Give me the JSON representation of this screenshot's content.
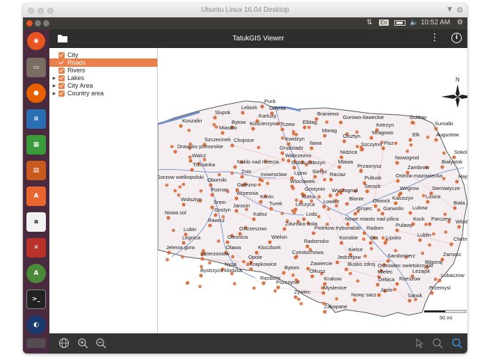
{
  "window": {
    "title": "Ubuntu Linux 16.04 Desktop"
  },
  "top_panel": {
    "lang": "En",
    "time": "10:52 AM"
  },
  "app": {
    "title": "TatukGIS Viewer"
  },
  "layers": [
    {
      "label": "City",
      "selected": false,
      "expandable": false,
      "checked": true
    },
    {
      "label": "Roads",
      "selected": true,
      "expandable": false,
      "checked": true
    },
    {
      "label": "Rivers",
      "selected": false,
      "expandable": false,
      "checked": true
    },
    {
      "label": "Lakes",
      "selected": false,
      "expandable": true,
      "checked": true
    },
    {
      "label": "City Area",
      "selected": false,
      "expandable": true,
      "checked": true
    },
    {
      "label": "Country area",
      "selected": false,
      "expandable": true,
      "checked": true
    }
  ],
  "map": {
    "north_label": "N",
    "scale_label": "50 mi",
    "cities": [
      "Puck",
      "Gdynia",
      "Lebork",
      "Slupsk",
      "Kartuzy",
      "Koscierzyna",
      "Tczew",
      "Bytow",
      "Braniewo",
      "Gorowo-ilaweckie",
      "Goldap",
      "Sumalki",
      "Augustow",
      "Koszalin",
      "Miastko",
      "Elblag",
      "Ketrzyn",
      "Mragowo",
      "Elk",
      "Morag",
      "Olsztyn",
      "Szczecinek",
      "Chojnice",
      "Kwidzyn",
      "Ilawa",
      "Szczytno",
      "Pisz",
      "Drawsko pomorskie",
      "Grudziadz",
      "Nidzica",
      "Sokolka",
      "Walcz",
      "Wabrzezno",
      "Nowogrod",
      "Bialystok",
      "Trzcianka",
      "Naklo nad notecia",
      "Golub dobrzyn",
      "Mlawa",
      "Zambrow",
      "Hajnowka",
      "Przasnysz",
      "Ostrow mazowiecka",
      "Znin",
      "Inowroclaw",
      "Lipno",
      "Sierpc",
      "Raciaz",
      "Pultusk",
      "Gorzow wielkopolski",
      "Oborniki",
      "Wloclawek",
      "Wegrow",
      "Siemiatycze",
      "Gostynin",
      "Serock",
      "Poznan",
      "Gniezno",
      "Wyszogrod",
      "Kaluszyn",
      "Losice",
      "Konin",
      "Kutno",
      "Blonie",
      "Otwock",
      "Biala podlaska",
      "Wrzesnia",
      "Srem",
      "Jarocin",
      "Turek",
      "Lowicz",
      "Garwolin",
      "Lukow",
      "Wolsztyn",
      "Gostyn",
      "Leczyca",
      "Grojec",
      "Nowa sol",
      "Rawicz",
      "Kalisz",
      "Zdunska wola",
      "Lodz",
      "Nowe miasto nad pilica",
      "Pulawy",
      "Kock",
      "Parczew",
      "Wlodawa",
      "Lubin",
      "Ostrzeszow",
      "Piotrkow trybunalski",
      "Radom",
      "Lublin",
      "Legnica",
      "Olesnica",
      "Wielun",
      "Radomsko",
      "Konskie",
      "Ilza",
      "Lipsko",
      "Chelm",
      "Jelenia gora",
      "Dzierzoniow",
      "Olawa",
      "Kluczbork",
      "Czestochowa",
      "Kielce",
      "Sandomierz",
      "Zamosc",
      "Nysa",
      "Opole",
      "Krapkowice",
      "Jedrzejow",
      "Busko zdroj",
      "Ostrowiec swietokrzyski",
      "Bilgoraj",
      "Bystrzyca klodzka",
      "Bytom",
      "Zawiercie",
      "Olkusz",
      "Mielec",
      "Lezajsk",
      "Lubaczow",
      "Raciborz",
      "Pszczyna",
      "Krakow",
      "Debica",
      "Rzeszow",
      "Przemysl",
      "Zywiec",
      "Myslenice",
      "Jaslo",
      "Nowy sacz",
      "Sanok",
      "Zakopane"
    ]
  },
  "colors": {
    "accent": "#e97f4a",
    "dark_panel": "#2e2e2e",
    "city_dot": "#d8703f",
    "river": "#6f90c8",
    "country_fill": "#f5eef1"
  }
}
